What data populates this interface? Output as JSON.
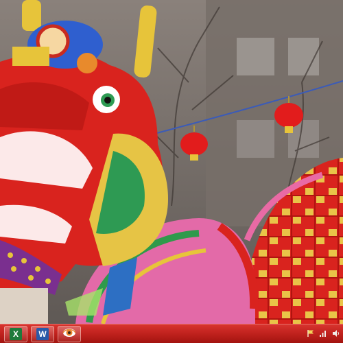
{
  "wallpaper": {
    "subject": "chinese-dragon-parade",
    "colors": {
      "dragon_red": "#d9231e",
      "gold": "#e7c43a",
      "lantern_red": "#e21c1c",
      "sky": "#8d8580"
    }
  },
  "taskbar": {
    "color": "#c2231f",
    "pinned": [
      {
        "name": "excel",
        "glyph": "X",
        "color": "#1e7a3b"
      },
      {
        "name": "word",
        "glyph": "W",
        "color": "#2a5aa8"
      },
      {
        "name": "media-player",
        "glyph": "",
        "color": "#e8822a"
      }
    ],
    "tray": [
      {
        "name": "flag-icon"
      },
      {
        "name": "network-icon"
      },
      {
        "name": "volume-icon"
      }
    ]
  }
}
